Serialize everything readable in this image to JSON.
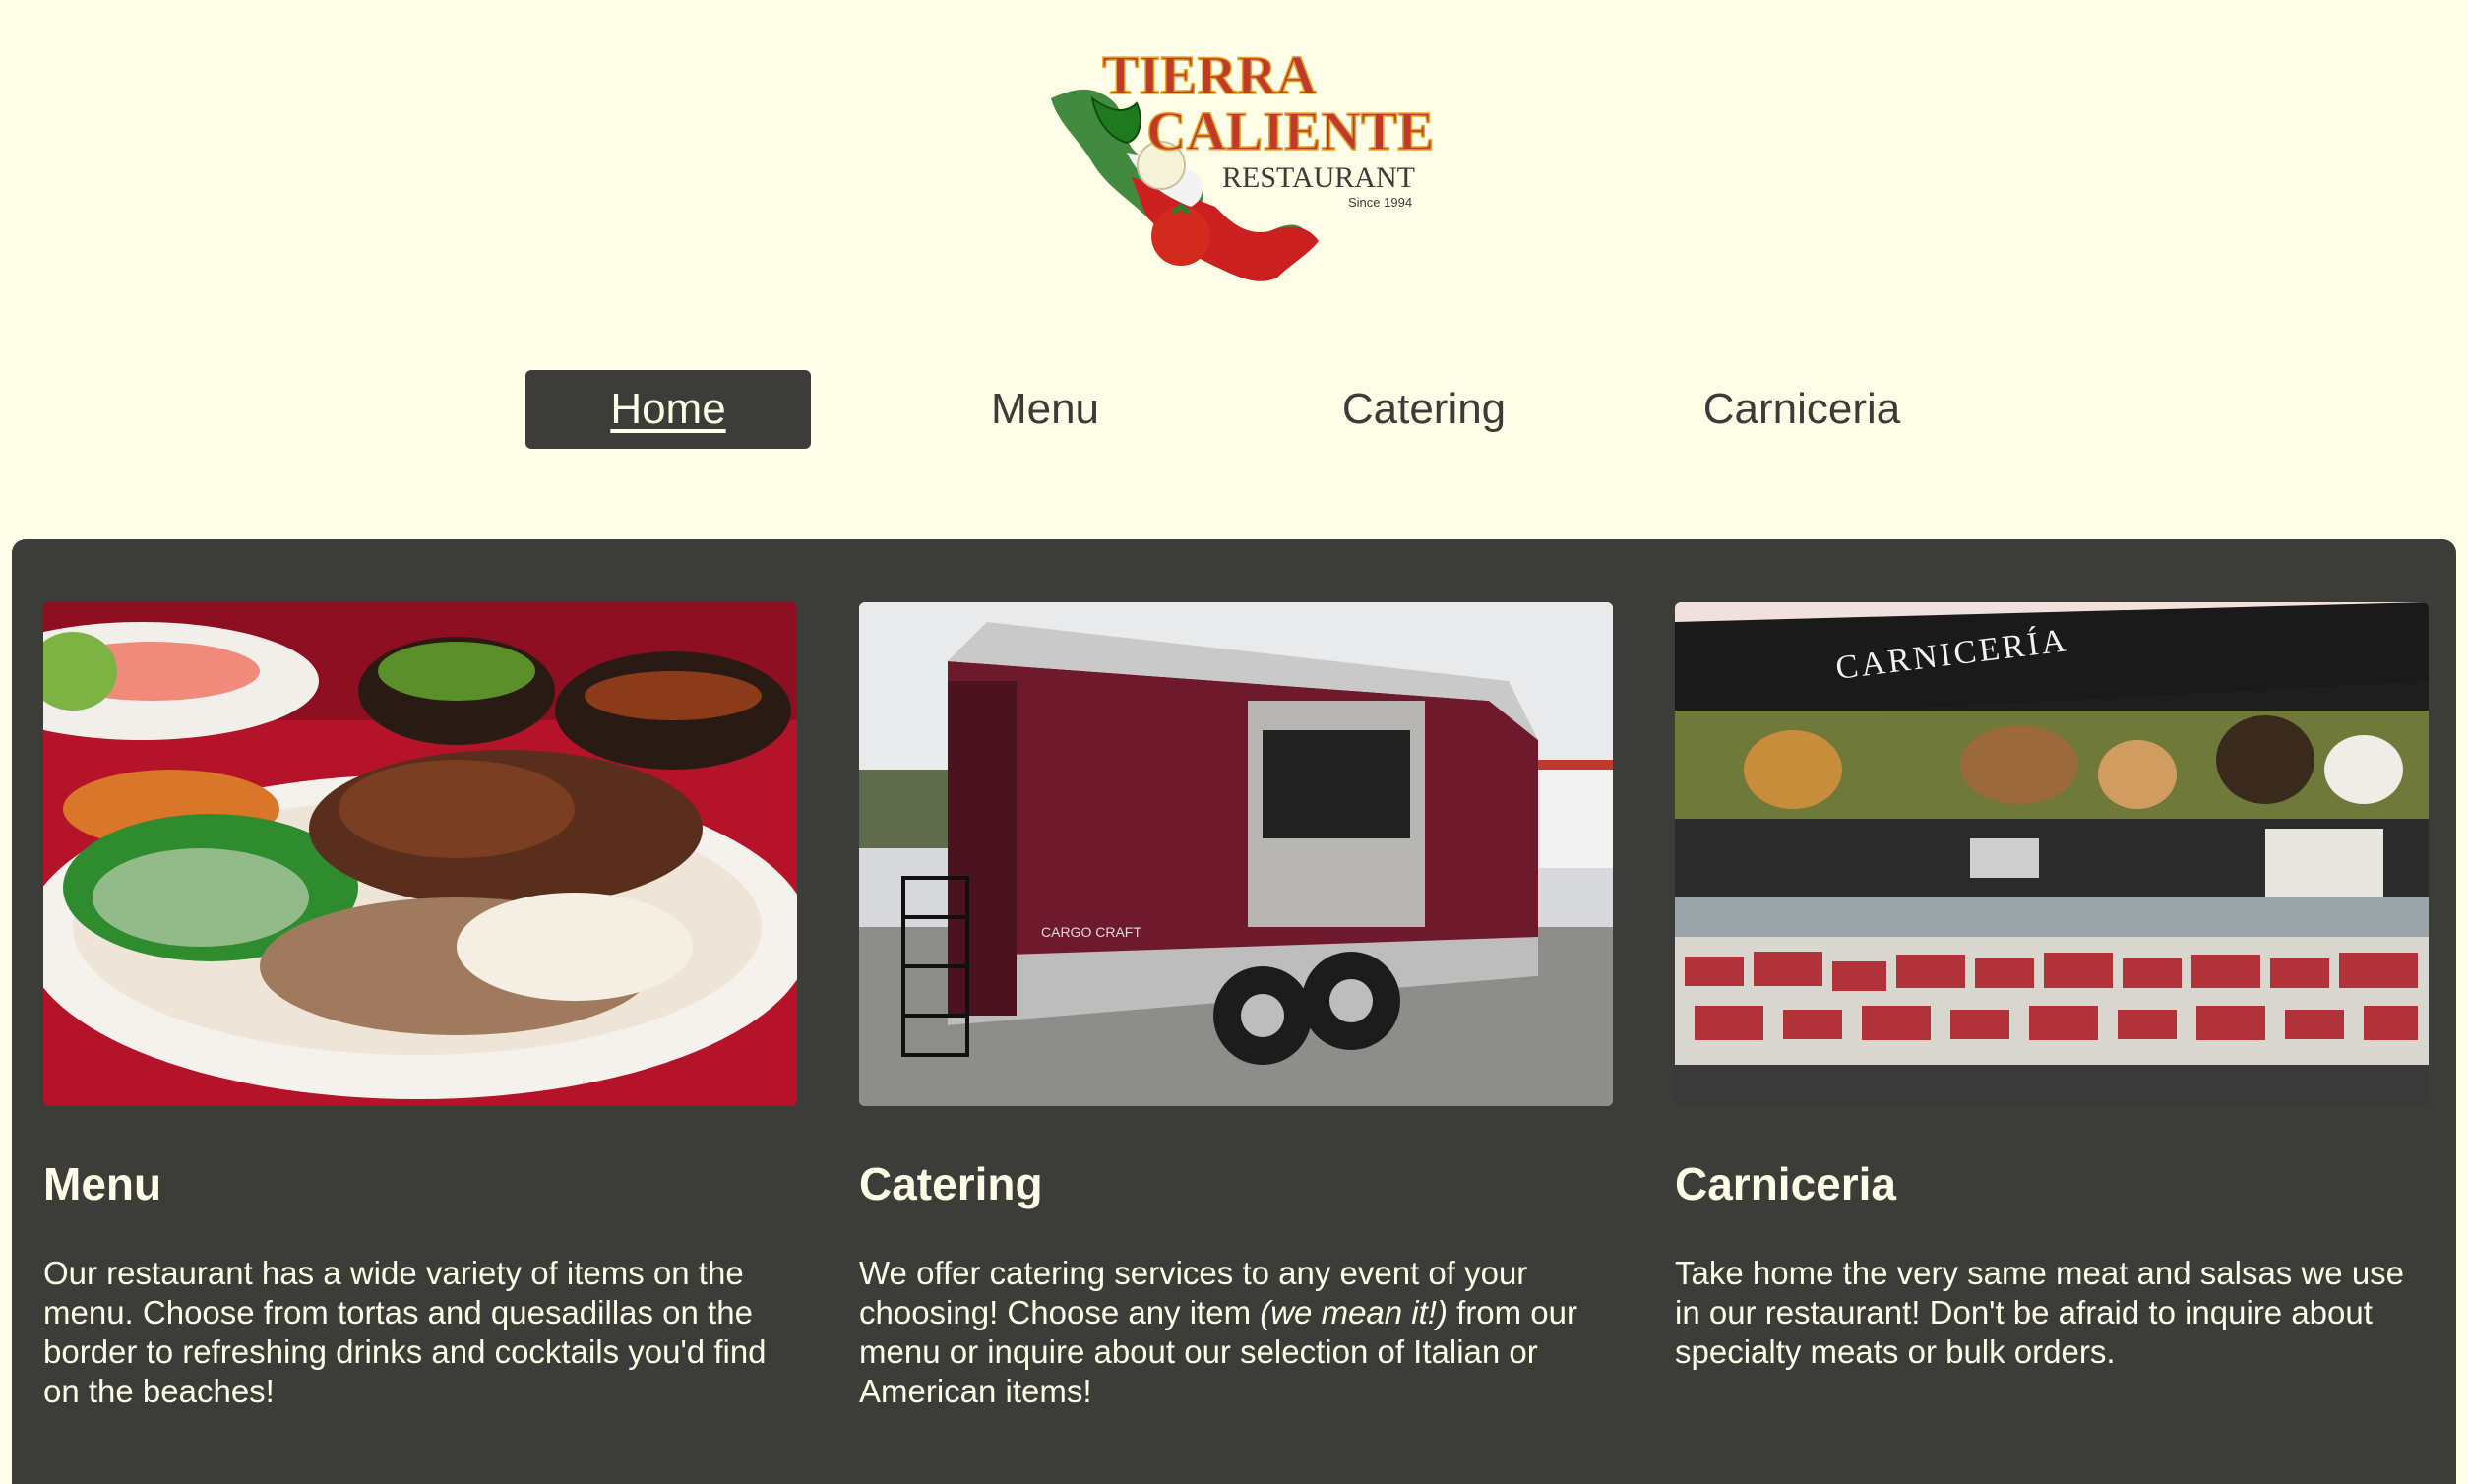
{
  "logo": {
    "line1": "TIERRA",
    "line2": "CALIENTE",
    "line3": "RESTAURANT",
    "since": "Since 1994"
  },
  "nav": {
    "items": [
      {
        "label": "Home",
        "active": true
      },
      {
        "label": "Menu",
        "active": false
      },
      {
        "label": "Catering",
        "active": false
      },
      {
        "label": "Carniceria",
        "active": false
      }
    ]
  },
  "cards": [
    {
      "title": "Menu",
      "text": "Our restaurant has a wide variety of items on the menu. Choose from tortas and quesadillas on the border to refreshing drinks and cocktails you'd find on the beaches!"
    },
    {
      "title": "Catering",
      "text_before": "We offer catering services to any event of your choosing! Choose any item ",
      "text_em": "(we mean it!)",
      "text_after": " from our menu or inquire about our selection of Italian or American items!",
      "trailer_brand": "CARGO CRAFT"
    },
    {
      "title": "Carniceria",
      "text": "Take home the very same meat and salsas we use in our restaurant! Don't be afraid to inquire about specialty meats or bulk orders.",
      "sign": "CARNICERÍA"
    }
  ],
  "colors": {
    "background": "#fefde8",
    "panel": "#3c3c39",
    "text_light": "#fefde8",
    "text_dark": "#3b3b38"
  }
}
